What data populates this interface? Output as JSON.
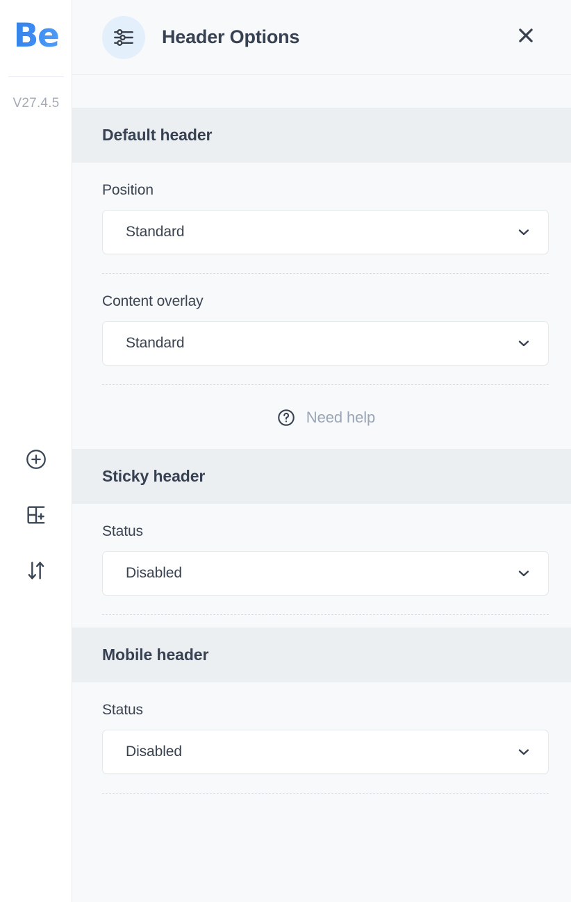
{
  "rail": {
    "logo_text": "Be",
    "version": "V27.4.5",
    "tools": [
      {
        "name": "add-element-button",
        "icon": "plus-circle-icon"
      },
      {
        "name": "add-section-button",
        "icon": "layout-add-icon"
      },
      {
        "name": "reorder-button",
        "icon": "sort-arrows-icon"
      }
    ]
  },
  "topbar": {
    "icon": "sliders-icon",
    "title": "Header Options",
    "close_icon": "close-icon"
  },
  "sections": [
    {
      "title": "Default header",
      "fields": [
        {
          "label": "Position",
          "value": "Standard",
          "caret": "chevron-down-icon"
        },
        {
          "label": "Content overlay",
          "value": "Standard",
          "caret": "chevron-down-icon"
        }
      ],
      "help": {
        "icon": "question-circle-icon",
        "label": "Need help"
      }
    },
    {
      "title": "Sticky header",
      "fields": [
        {
          "label": "Status",
          "value": "Disabled",
          "caret": "chevron-down-icon"
        }
      ]
    },
    {
      "title": "Mobile header",
      "fields": [
        {
          "label": "Status",
          "value": "Disabled",
          "caret": "chevron-down-icon"
        }
      ]
    }
  ],
  "colors": {
    "brand_blue": "#3d8bf2",
    "panel_bg": "#f7f9fa",
    "section_head_bg": "#eceff1",
    "text_dark": "#374151",
    "muted": "#9aa5b6"
  }
}
